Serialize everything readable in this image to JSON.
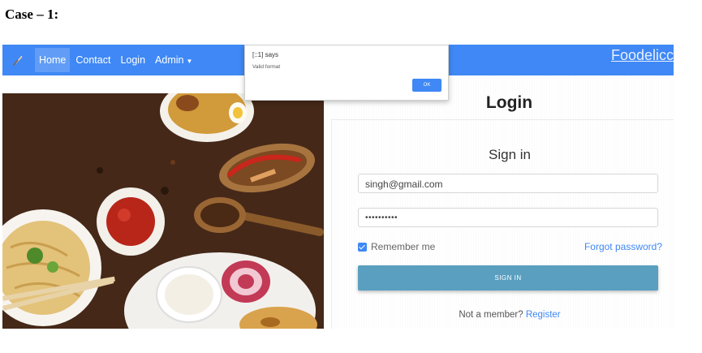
{
  "case_label": "Case – 1:",
  "navbar": {
    "links": [
      "Home",
      "Contact",
      "Login",
      "Admin"
    ],
    "brand": "Foodelicc",
    "logo_icon": "feather-icon",
    "color": "#3f88f5"
  },
  "dialog": {
    "title": "[::1] says",
    "message": "Valid format",
    "ok_label": "OK"
  },
  "login": {
    "heading": "Login",
    "card_title": "Sign in",
    "email_value": "singh@gmail.com",
    "password_value": "••••••••••",
    "remember_label": "Remember me",
    "remember_checked": true,
    "forgot_label": "Forgot password?",
    "signin_label": "SIGN IN",
    "not_member_text": "Not a member?",
    "register_label": "Register",
    "button_color": "#5a9fc0"
  }
}
